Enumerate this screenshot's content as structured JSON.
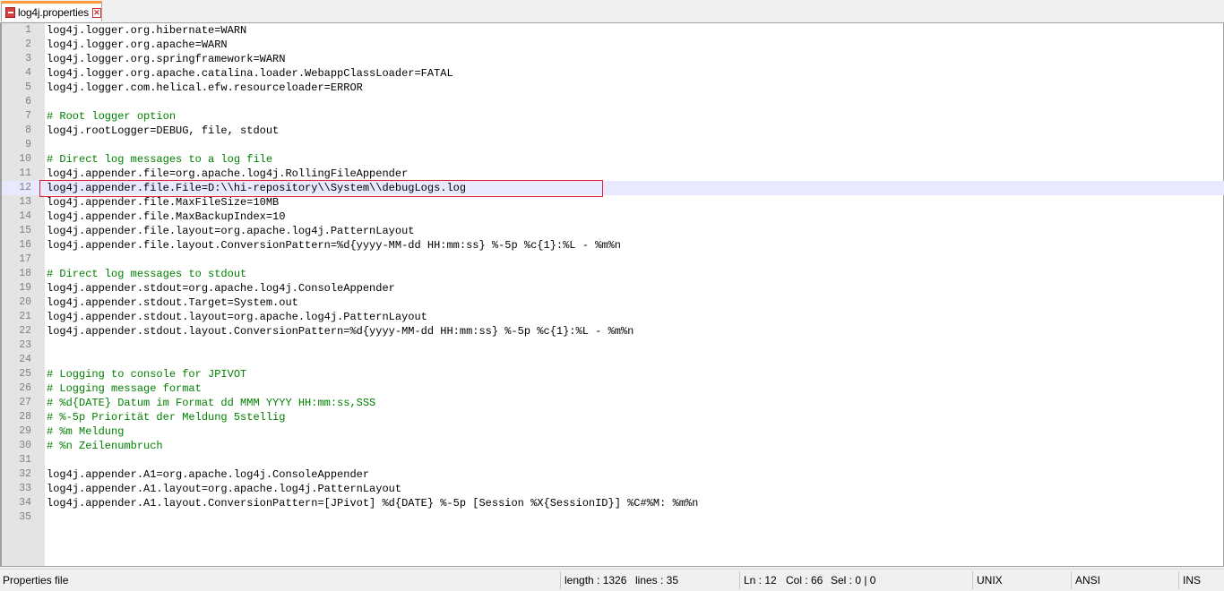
{
  "tab": {
    "label": "log4j.properties",
    "close_glyph": "✕"
  },
  "editor": {
    "current_line": 12,
    "lines": [
      {
        "n": "1",
        "text": "log4j.logger.org.hibernate=WARN",
        "comment": false
      },
      {
        "n": "2",
        "text": "log4j.logger.org.apache=WARN",
        "comment": false
      },
      {
        "n": "3",
        "text": "log4j.logger.org.springframework=WARN",
        "comment": false
      },
      {
        "n": "4",
        "text": "log4j.logger.org.apache.catalina.loader.WebappClassLoader=FATAL",
        "comment": false
      },
      {
        "n": "5",
        "text": "log4j.logger.com.helical.efw.resourceloader=ERROR",
        "comment": false
      },
      {
        "n": "6",
        "text": "",
        "comment": false
      },
      {
        "n": "7",
        "text": "# Root logger option",
        "comment": true
      },
      {
        "n": "8",
        "text": "log4j.rootLogger=DEBUG, file, stdout",
        "comment": false
      },
      {
        "n": "9",
        "text": "",
        "comment": false
      },
      {
        "n": "10",
        "text": "# Direct log messages to a log file",
        "comment": true
      },
      {
        "n": "11",
        "text": "log4j.appender.file=org.apache.log4j.RollingFileAppender",
        "comment": false
      },
      {
        "n": "12",
        "text": "log4j.appender.file.File=D:\\\\hi-repository\\\\System\\\\debugLogs.log",
        "comment": false
      },
      {
        "n": "13",
        "text": "log4j.appender.file.MaxFileSize=10MB",
        "comment": false
      },
      {
        "n": "14",
        "text": "log4j.appender.file.MaxBackupIndex=10",
        "comment": false
      },
      {
        "n": "15",
        "text": "log4j.appender.file.layout=org.apache.log4j.PatternLayout",
        "comment": false
      },
      {
        "n": "16",
        "text": "log4j.appender.file.layout.ConversionPattern=%d{yyyy-MM-dd HH:mm:ss} %-5p %c{1}:%L - %m%n",
        "comment": false
      },
      {
        "n": "17",
        "text": "",
        "comment": false
      },
      {
        "n": "18",
        "text": "# Direct log messages to stdout",
        "comment": true
      },
      {
        "n": "19",
        "text": "log4j.appender.stdout=org.apache.log4j.ConsoleAppender",
        "comment": false
      },
      {
        "n": "20",
        "text": "log4j.appender.stdout.Target=System.out",
        "comment": false
      },
      {
        "n": "21",
        "text": "log4j.appender.stdout.layout=org.apache.log4j.PatternLayout",
        "comment": false
      },
      {
        "n": "22",
        "text": "log4j.appender.stdout.layout.ConversionPattern=%d{yyyy-MM-dd HH:mm:ss} %-5p %c{1}:%L - %m%n",
        "comment": false
      },
      {
        "n": "23",
        "text": "",
        "comment": false
      },
      {
        "n": "24",
        "text": "",
        "comment": false
      },
      {
        "n": "25",
        "text": "# Logging to console for JPIVOT",
        "comment": true
      },
      {
        "n": "26",
        "text": "# Logging message format",
        "comment": true
      },
      {
        "n": "27",
        "text": "# %d{DATE} Datum im Format dd MMM YYYY HH:mm:ss,SSS",
        "comment": true
      },
      {
        "n": "28",
        "text": "# %-5p Priorität der Meldung 5stellig",
        "comment": true
      },
      {
        "n": "29",
        "text": "# %m Meldung",
        "comment": true
      },
      {
        "n": "30",
        "text": "# %n Zeilenumbruch",
        "comment": true
      },
      {
        "n": "31",
        "text": "",
        "comment": false
      },
      {
        "n": "32",
        "text": "log4j.appender.A1=org.apache.log4j.ConsoleAppender",
        "comment": false
      },
      {
        "n": "33",
        "text": "log4j.appender.A1.layout=org.apache.log4j.PatternLayout",
        "comment": false
      },
      {
        "n": "34",
        "text": "log4j.appender.A1.layout.ConversionPattern=[JPivot] %d{DATE} %-5p [Session %X{SessionID}] %C#%M: %m%n",
        "comment": false
      },
      {
        "n": "35",
        "text": "",
        "comment": false
      }
    ]
  },
  "statusbar": {
    "file_type": "Properties file",
    "length": "length : 1326",
    "lines": "lines : 35",
    "ln": "Ln : 12",
    "col": "Col : 66",
    "sel": "Sel : 0 | 0",
    "eol": "UNIX",
    "encoding": "ANSI",
    "mode": "INS"
  },
  "colors": {
    "comment": "#008000",
    "gutter": "#e4e4e4",
    "current_line": "#e8e8ff",
    "highlight_box": "#e02030",
    "tab_accent": "#fa9c3a"
  },
  "icons": [
    "file-icon",
    "close-icon"
  ]
}
